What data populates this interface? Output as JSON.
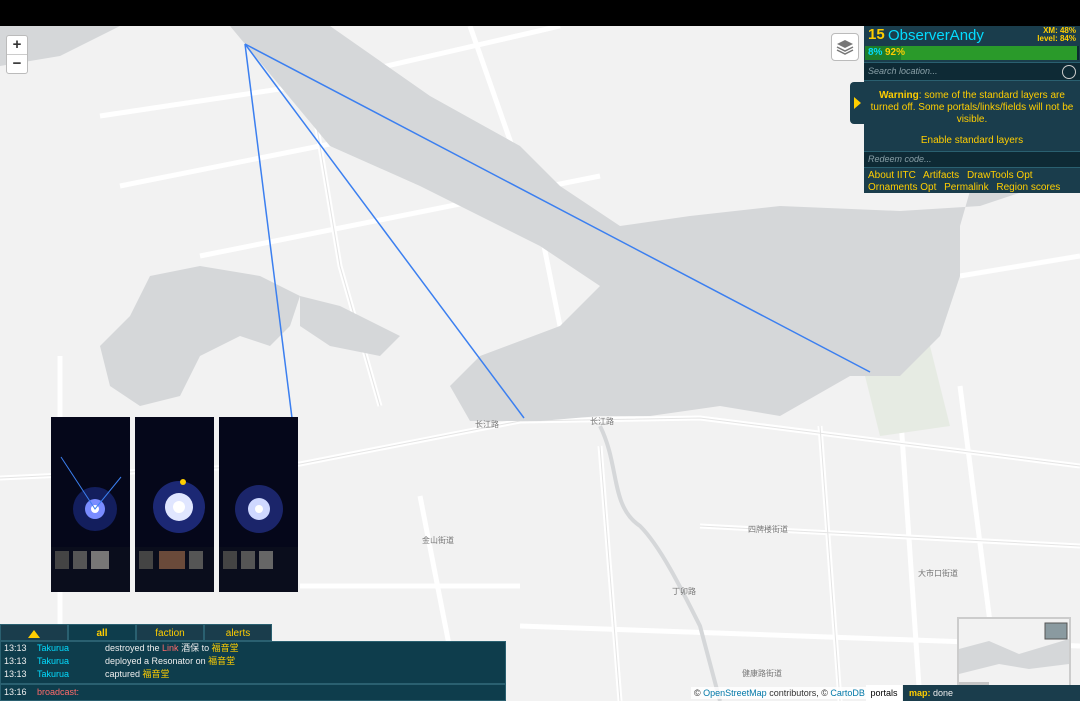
{
  "player": {
    "level": "15",
    "name": "ObserverAndy",
    "xm": "XM: 48%",
    "level_pct": "level: 84%",
    "bar_left": "8%",
    "bar_right": "92%",
    "xm_fill": 0.48
  },
  "search": {
    "placeholder": "Search location..."
  },
  "warning": {
    "bold": "Warning",
    "text": ": some of the standard layers are turned off. Some portals/links/fields will not be visible.",
    "enable": "Enable standard layers"
  },
  "redeem": {
    "placeholder": "Redeem code..."
  },
  "toolbox": [
    "About IITC",
    "Artifacts",
    "DrawTools Opt",
    "Ornaments Opt",
    "Permalink",
    "Region scores"
  ],
  "zoom": {
    "in": "+",
    "out": "−"
  },
  "map_labels": [
    "长江路",
    "长江路",
    "金山街道",
    "四牌楼街道",
    "大市口街道",
    "健康路街道",
    "丁卯路"
  ],
  "chat": {
    "tabs": [
      "all",
      "faction",
      "alerts"
    ],
    "messages": [
      {
        "time": "13:13",
        "nick": "Takurua",
        "pre": "destroyed the ",
        "red": "Link",
        "mid": " 酒保 ",
        "post": "to ",
        "yellow": "福音堂"
      },
      {
        "time": "13:13",
        "nick": "Takurua",
        "pre": "deployed a Resonator on ",
        "red": "",
        "mid": "",
        "post": "",
        "yellow": "福音堂"
      },
      {
        "time": "13:13",
        "nick": "Takurua",
        "pre": "captured ",
        "red": "",
        "mid": "",
        "post": "",
        "yellow": "福音堂"
      }
    ],
    "input_time": "13:16",
    "input_label": "broadcast:"
  },
  "attribution": {
    "prefix": "©",
    "osm": "OpenStreetMap",
    "middle": "contributors, ©",
    "carto": "CartoDB"
  },
  "status": {
    "portals": "portals",
    "map_label": "map:",
    "map_value": "done"
  },
  "colors": {
    "sidebar_bg": "#1a3d4c",
    "accent": "#ffce00",
    "cyan": "#03dcff",
    "link_line": "#3b7ff0",
    "water": "#d5d7d9"
  }
}
